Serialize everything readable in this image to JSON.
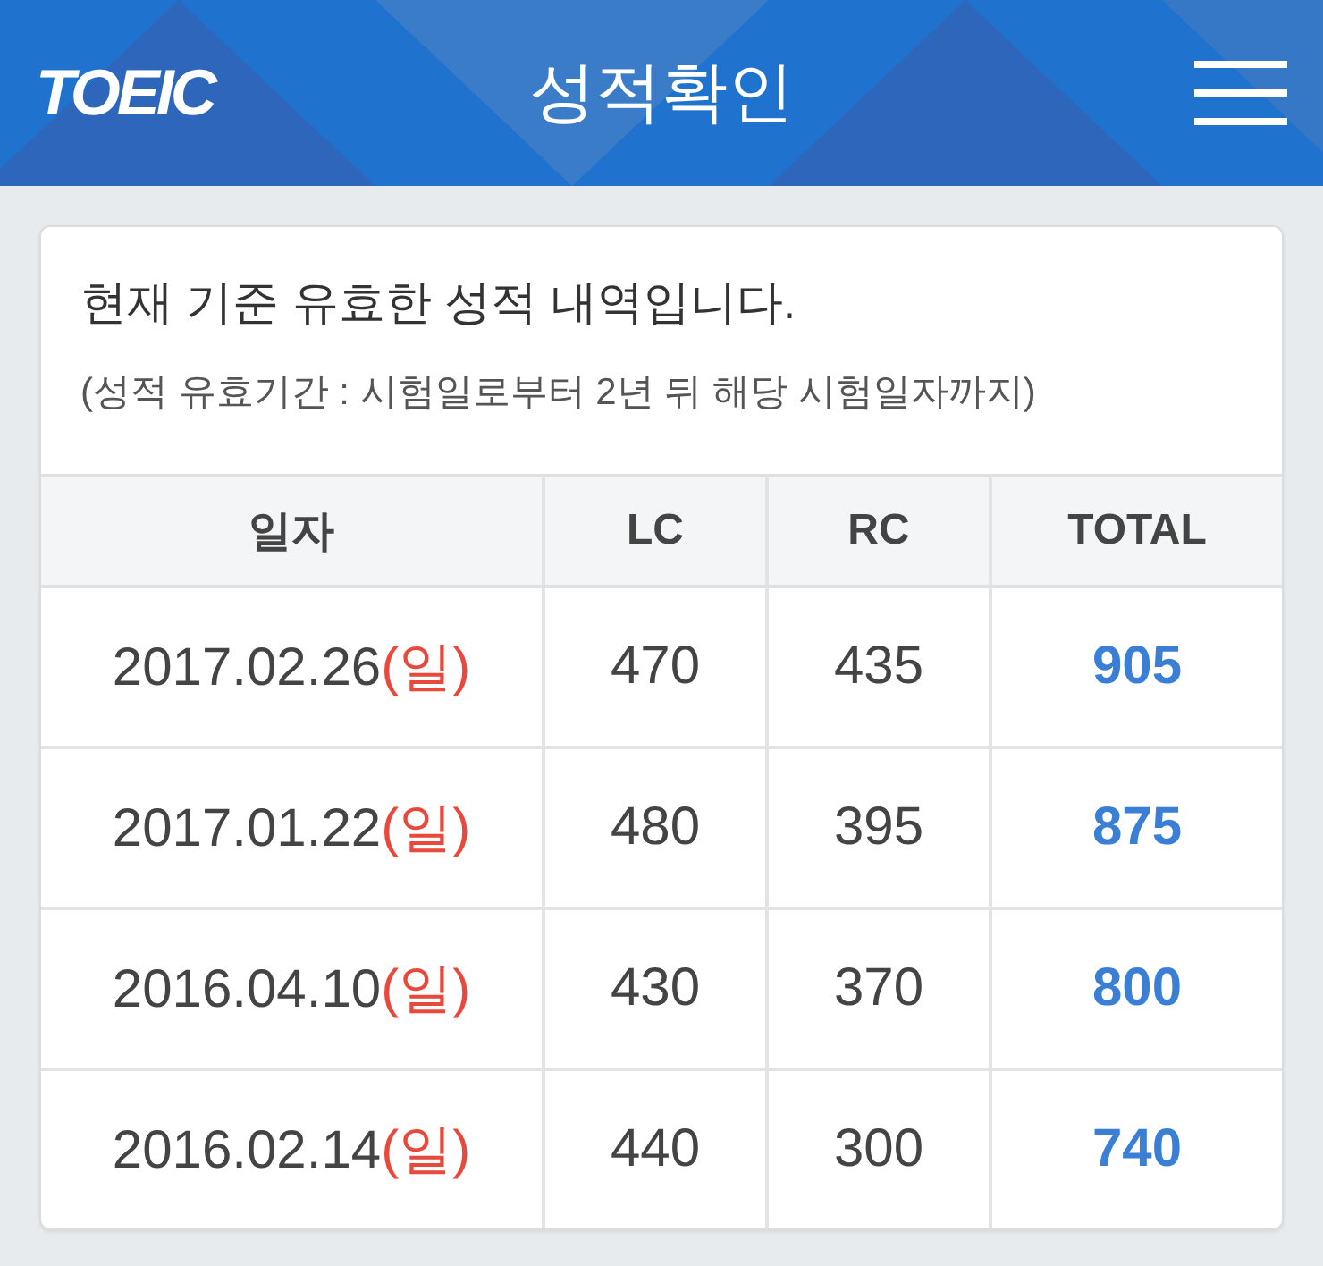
{
  "header": {
    "logo": "TOEIC",
    "title": "성적확인"
  },
  "notice": {
    "heading": "현재 기준 유효한 성적 내역입니다.",
    "note": "(성적 유효기간 : 시험일로부터 2년 뒤 해당 시험일자까지)"
  },
  "table": {
    "columns": [
      "일자",
      "LC",
      "RC",
      "TOTAL"
    ],
    "rows": [
      {
        "date": "2017.02.26",
        "weekday": "(일)",
        "lc": "470",
        "rc": "435",
        "total": "905"
      },
      {
        "date": "2017.01.22",
        "weekday": "(일)",
        "lc": "480",
        "rc": "395",
        "total": "875"
      },
      {
        "date": "2016.04.10",
        "weekday": "(일)",
        "lc": "430",
        "rc": "370",
        "total": "800"
      },
      {
        "date": "2016.02.14",
        "weekday": "(일)",
        "lc": "440",
        "rc": "300",
        "total": "740"
      }
    ]
  }
}
